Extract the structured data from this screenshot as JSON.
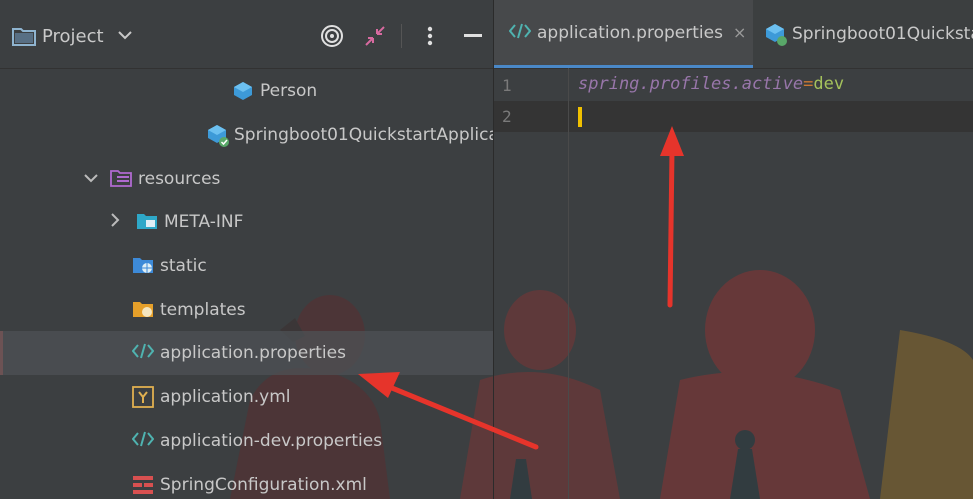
{
  "project_panel": {
    "title": "Project",
    "icons": {
      "dropdown": "chevron-down-icon",
      "locate": "target-icon",
      "collapse": "collapse-icon",
      "more": "more-vert-icon",
      "hide": "minimize-icon"
    }
  },
  "tree": {
    "items": [
      {
        "label": "Person",
        "icon": "java-class-icon"
      },
      {
        "label": "Springboot01QuickstartApplicat",
        "icon": "spring-boot-app-icon"
      },
      {
        "label": "resources",
        "icon": "resources-folder-icon",
        "expanded": true
      },
      {
        "label": "META-INF",
        "icon": "folder-icon",
        "expanded": false
      },
      {
        "label": "static",
        "icon": "web-folder-icon"
      },
      {
        "label": "templates",
        "icon": "templates-folder-icon"
      },
      {
        "label": "application.properties",
        "icon": "properties-file-icon",
        "selected": true
      },
      {
        "label": "application.yml",
        "icon": "yaml-file-icon"
      },
      {
        "label": "application-dev.properties",
        "icon": "properties-file-icon"
      },
      {
        "label": "SpringConfiguration.xml",
        "icon": "spring-xml-icon"
      }
    ]
  },
  "editor": {
    "tabs": [
      {
        "label": "application.properties",
        "active": true,
        "close": "×"
      },
      {
        "label": "Springboot01Quickstar",
        "active": false
      }
    ],
    "line_numbers": [
      "1",
      "2"
    ],
    "code": {
      "key": "spring.profiles.active",
      "eq": "=",
      "value": "dev"
    }
  },
  "colors": {
    "panel_bg": "#3c3f41",
    "key_purple": "#9876aa",
    "value_green": "#a5c25c",
    "caret_yellow": "#f0c000",
    "arrow_red": "#e6342b",
    "active_tab_underline": "#4a88c7"
  }
}
